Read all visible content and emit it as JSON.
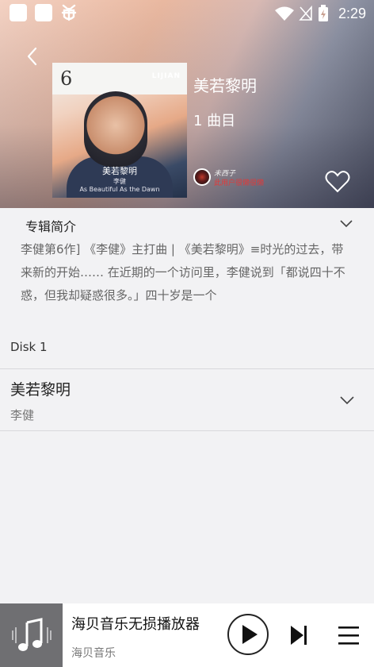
{
  "status_bar": {
    "time": "2:29"
  },
  "header": {
    "album_title": "美若黎明",
    "track_count": "1 曲目",
    "uploader": {
      "name": "未西子",
      "description": "此用户很懒很懒"
    }
  },
  "cover": {
    "number": "6",
    "brand": "LIJIAN",
    "title": "美若黎明",
    "artist": "李健",
    "subtitle": "As Beautiful As the Dawn"
  },
  "intro": {
    "heading": "专辑简介",
    "text": "李健第6作] 《李健》主打曲 | 《美若黎明》≡时光的过去，带来新的开始…… 在近期的一个访问里，李健说到「都说四十不惑，但我却疑惑很多。」四十岁是一个"
  },
  "disk_label": "Disk 1",
  "songs": [
    {
      "title": "美若黎明",
      "artist": "李健"
    }
  ],
  "player": {
    "title": "海贝音乐无损播放器",
    "subtitle": "海贝音乐"
  },
  "icons": {
    "back": "back-arrow-icon",
    "heart": "heart-icon",
    "chevron": "chevron-down-icon",
    "play": "play-icon",
    "next": "skip-next-icon",
    "menu": "menu-icon",
    "note": "music-note-icon"
  },
  "colors": {
    "accent_red": "#e03a3a",
    "bg": "#f2f2f4",
    "player_art": "#6f6f72"
  }
}
